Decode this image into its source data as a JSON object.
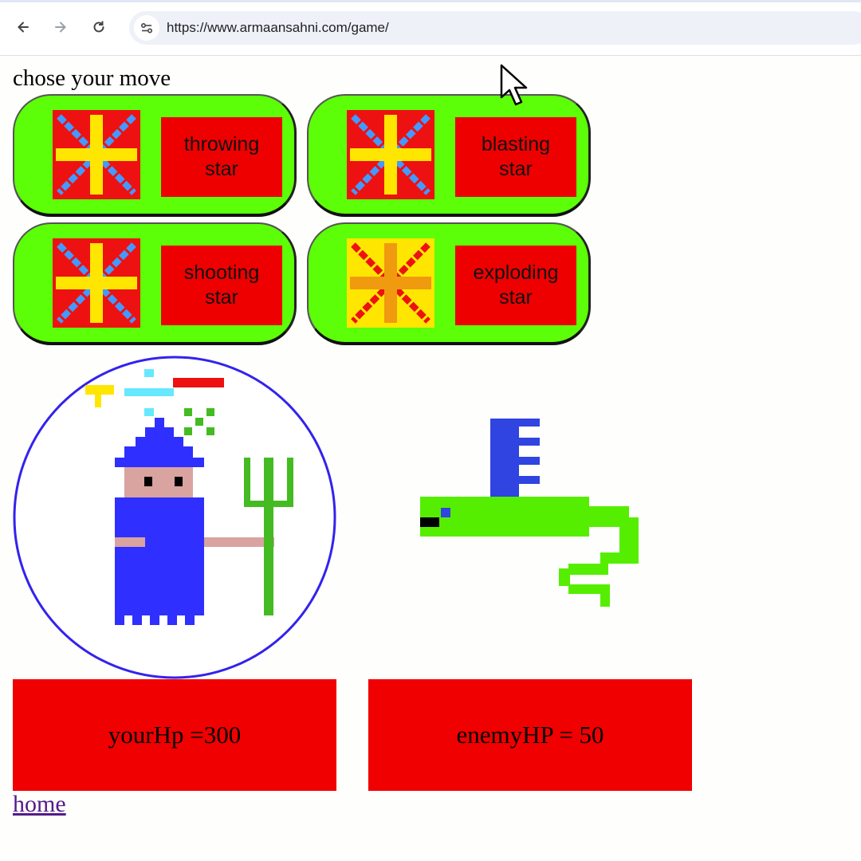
{
  "browser": {
    "url": "https://www.armaansahni.com/game/",
    "icons": {
      "back": "arrow-left-icon",
      "forward": "arrow-right-icon",
      "reload": "reload-icon",
      "site_info": "tune-icon"
    }
  },
  "page": {
    "heading": "chose your move",
    "moves": [
      {
        "label": "throwing\nstar",
        "icon": "star-icon",
        "icon_style": "red-yellow-blue"
      },
      {
        "label": "blasting\nstar",
        "icon": "star-icon",
        "icon_style": "red-yellow-blue"
      },
      {
        "label": "shooting\nstar",
        "icon": "star-icon",
        "icon_style": "red-yellow-blue"
      },
      {
        "label": "exploding\nstar",
        "icon": "star-icon",
        "icon_style": "yellow-orange-red"
      }
    ],
    "player_sprite": "wizard-with-pitchfork",
    "enemy_sprite": "green-serpent-with-comb",
    "your_hp_text": "yourHp =300",
    "enemy_hp_text": "enemyHP = 50",
    "home_link": "home"
  },
  "colors": {
    "card_green": "#5cff08",
    "label_red": "#ee0000",
    "hp_red": "#f00000",
    "wizard_blue": "#2f2fff",
    "link_purple": "#551a8b"
  }
}
